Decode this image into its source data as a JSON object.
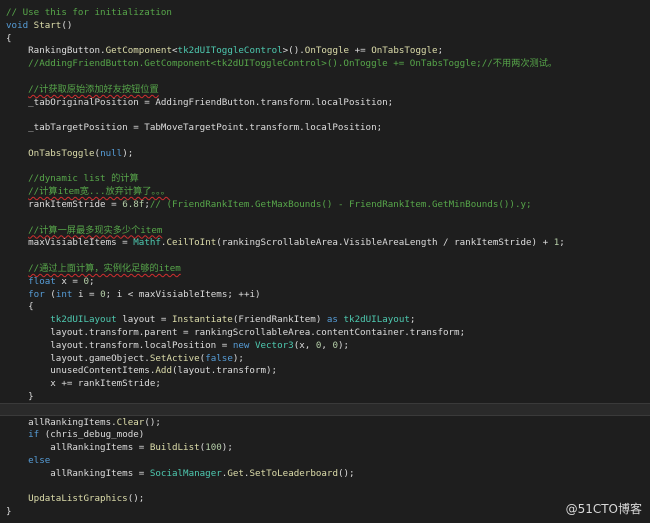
{
  "editor": {
    "lines": [
      {
        "indent": "",
        "tokens": [
          {
            "k": "c",
            "t": "// Use this for initialization"
          }
        ]
      },
      {
        "indent": "",
        "tokens": [
          {
            "k": "k",
            "t": "void "
          },
          {
            "k": "m",
            "t": "Start"
          },
          {
            "k": "p",
            "t": "()"
          }
        ]
      },
      {
        "indent": "",
        "tokens": [
          {
            "k": "p",
            "t": "{"
          }
        ]
      },
      {
        "indent": "    ",
        "tokens": [
          {
            "k": "p",
            "t": "RankingButton."
          },
          {
            "k": "m",
            "t": "GetComponent"
          },
          {
            "k": "p",
            "t": "<"
          },
          {
            "k": "t",
            "t": "tk2dUIToggleControl"
          },
          {
            "k": "p",
            "t": ">()."
          },
          {
            "k": "m",
            "t": "OnToggle"
          },
          {
            "k": "p",
            "t": " += "
          },
          {
            "k": "m",
            "t": "OnTabsToggle"
          },
          {
            "k": "p",
            "t": ";"
          }
        ]
      },
      {
        "indent": "    ",
        "tokens": [
          {
            "k": "c",
            "t": "//AddingFriendButton.GetComponent<tk2dUIToggleControl>().OnToggle += OnTabsToggle;//不用两次测试。"
          }
        ]
      },
      {
        "indent": "",
        "tokens": []
      },
      {
        "indent": "    ",
        "tokens": [
          {
            "k": "c",
            "t": "//计获取原始添加好友按钮位置"
          }
        ]
      },
      {
        "indent": "    ",
        "tokens": [
          {
            "k": "p",
            "t": "_tabOriginalPosition = AddingFriendButton.transform.localPosition;"
          }
        ]
      },
      {
        "indent": "",
        "tokens": []
      },
      {
        "indent": "    ",
        "tokens": [
          {
            "k": "p",
            "t": "_tabTargetPosition = TabMoveTargetPoint.transform.localPosition;"
          }
        ]
      },
      {
        "indent": "",
        "tokens": []
      },
      {
        "indent": "    ",
        "tokens": [
          {
            "k": "m",
            "t": "OnTabsToggle"
          },
          {
            "k": "p",
            "t": "("
          },
          {
            "k": "k",
            "t": "null"
          },
          {
            "k": "p",
            "t": ");"
          }
        ]
      },
      {
        "indent": "",
        "tokens": []
      },
      {
        "indent": "    ",
        "tokens": [
          {
            "k": "c",
            "t": "//dynamic list 的计算"
          }
        ]
      },
      {
        "indent": "    ",
        "tokens": [
          {
            "k": "c",
            "t": "//计算item宽...放弃计算了。。。"
          }
        ]
      },
      {
        "indent": "    ",
        "tokens": [
          {
            "k": "p",
            "t": "rankItemStride = "
          },
          {
            "k": "n",
            "t": "6.8f"
          },
          {
            "k": "p",
            "t": ";"
          },
          {
            "k": "c",
            "t": "// (FriendRankItem.GetMaxBounds() - FriendRankItem.GetMinBounds()).y;"
          }
        ]
      },
      {
        "indent": "",
        "tokens": []
      },
      {
        "indent": "    ",
        "tokens": [
          {
            "k": "c",
            "t": "//计算一屏最多现实多少个item"
          }
        ]
      },
      {
        "indent": "    ",
        "tokens": [
          {
            "k": "p",
            "t": "maxVisiableItems = "
          },
          {
            "k": "t",
            "t": "Mathf"
          },
          {
            "k": "p",
            "t": "."
          },
          {
            "k": "m",
            "t": "CeilToInt"
          },
          {
            "k": "p",
            "t": "(rankingScrollableArea.VisibleAreaLength / rankItemStride) + "
          },
          {
            "k": "n",
            "t": "1"
          },
          {
            "k": "p",
            "t": ";"
          }
        ]
      },
      {
        "indent": "",
        "tokens": []
      },
      {
        "indent": "    ",
        "tokens": [
          {
            "k": "c",
            "t": "//通过上面计算，实例化足够的item"
          }
        ]
      },
      {
        "indent": "    ",
        "tokens": [
          {
            "k": "k",
            "t": "float"
          },
          {
            "k": "p",
            "t": " x = "
          },
          {
            "k": "n",
            "t": "0"
          },
          {
            "k": "p",
            "t": ";"
          }
        ]
      },
      {
        "indent": "    ",
        "tokens": [
          {
            "k": "k",
            "t": "for"
          },
          {
            "k": "p",
            "t": " ("
          },
          {
            "k": "k",
            "t": "int"
          },
          {
            "k": "p",
            "t": " i = "
          },
          {
            "k": "n",
            "t": "0"
          },
          {
            "k": "p",
            "t": "; i < maxVisiableItems; ++i)"
          }
        ]
      },
      {
        "indent": "    ",
        "tokens": [
          {
            "k": "p",
            "t": "{"
          }
        ]
      },
      {
        "indent": "        ",
        "tokens": [
          {
            "k": "t",
            "t": "tk2dUILayout"
          },
          {
            "k": "p",
            "t": " layout = "
          },
          {
            "k": "m",
            "t": "Instantiate"
          },
          {
            "k": "p",
            "t": "(FriendRankItem) "
          },
          {
            "k": "k",
            "t": "as "
          },
          {
            "k": "t",
            "t": "tk2dUILayout"
          },
          {
            "k": "p",
            "t": ";"
          }
        ]
      },
      {
        "indent": "        ",
        "tokens": [
          {
            "k": "p",
            "t": "layout.transform.parent = rankingScrollableArea.contentContainer.transform;"
          }
        ]
      },
      {
        "indent": "        ",
        "tokens": [
          {
            "k": "p",
            "t": "layout.transform.localPosition = "
          },
          {
            "k": "k",
            "t": "new "
          },
          {
            "k": "t",
            "t": "Vector3"
          },
          {
            "k": "p",
            "t": "(x, "
          },
          {
            "k": "n",
            "t": "0"
          },
          {
            "k": "p",
            "t": ", "
          },
          {
            "k": "n",
            "t": "0"
          },
          {
            "k": "p",
            "t": ");"
          }
        ]
      },
      {
        "indent": "        ",
        "tokens": [
          {
            "k": "p",
            "t": "layout.gameObject."
          },
          {
            "k": "m",
            "t": "SetActive"
          },
          {
            "k": "p",
            "t": "("
          },
          {
            "k": "k",
            "t": "false"
          },
          {
            "k": "p",
            "t": ");"
          }
        ]
      },
      {
        "indent": "        ",
        "tokens": [
          {
            "k": "p",
            "t": "unusedContentItems."
          },
          {
            "k": "m",
            "t": "Add"
          },
          {
            "k": "p",
            "t": "(layout.transform);"
          }
        ]
      },
      {
        "indent": "        ",
        "tokens": [
          {
            "k": "p",
            "t": "x += rankItemStride;"
          }
        ]
      },
      {
        "indent": "    ",
        "tokens": [
          {
            "k": "p",
            "t": "}"
          }
        ]
      },
      {
        "indent": "",
        "tokens": [],
        "current": true
      },
      {
        "indent": "    ",
        "tokens": [
          {
            "k": "p",
            "t": "allRankingItems."
          },
          {
            "k": "m",
            "t": "Clear"
          },
          {
            "k": "p",
            "t": "();"
          }
        ]
      },
      {
        "indent": "    ",
        "tokens": [
          {
            "k": "k",
            "t": "if"
          },
          {
            "k": "p",
            "t": " (chris_debug_mode)"
          }
        ]
      },
      {
        "indent": "        ",
        "tokens": [
          {
            "k": "p",
            "t": "allRankingItems = "
          },
          {
            "k": "m",
            "t": "BuildList"
          },
          {
            "k": "p",
            "t": "("
          },
          {
            "k": "n",
            "t": "100"
          },
          {
            "k": "p",
            "t": ");"
          }
        ]
      },
      {
        "indent": "    ",
        "tokens": [
          {
            "k": "k",
            "t": "else"
          }
        ]
      },
      {
        "indent": "        ",
        "tokens": [
          {
            "k": "p",
            "t": "allRankingItems = "
          },
          {
            "k": "t",
            "t": "SocialManager"
          },
          {
            "k": "p",
            "t": "."
          },
          {
            "k": "m",
            "t": "Get"
          },
          {
            "k": "p",
            "t": "."
          },
          {
            "k": "m",
            "t": "SetToLeaderboard"
          },
          {
            "k": "p",
            "t": "();"
          }
        ]
      },
      {
        "indent": "",
        "tokens": []
      },
      {
        "indent": "    ",
        "tokens": [
          {
            "k": "m",
            "t": "UpdataListGraphics"
          },
          {
            "k": "p",
            "t": "();"
          }
        ]
      },
      {
        "indent": "",
        "tokens": [
          {
            "k": "p",
            "t": "}"
          }
        ]
      }
    ],
    "colors": {
      "background": "#1e1e1e",
      "comment": "#57a64a",
      "keyword": "#569cd6",
      "type": "#4ec9b0",
      "method": "#dcdcaa",
      "number": "#b5cea8",
      "plain": "#dcdcdc"
    }
  },
  "watermark": "@51CTO博客"
}
